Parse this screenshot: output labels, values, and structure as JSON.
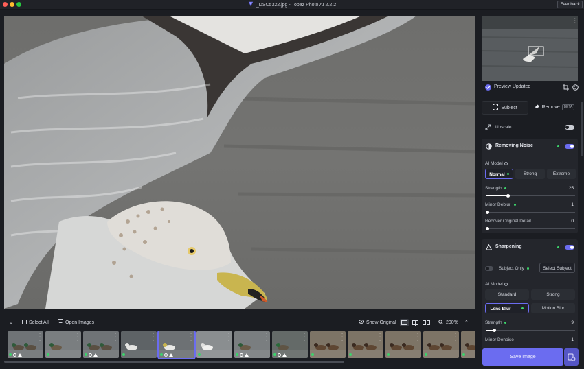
{
  "window": {
    "title": "_DSC5322.jpg - Topaz Photo AI 2.2.2",
    "feedback_label": "Feedback"
  },
  "bottombar": {
    "select_all": "Select All",
    "open_images": "Open Images",
    "show_original": "Show Original",
    "zoom": "200%"
  },
  "filmstrip": {
    "selected_index": 4,
    "thumbnails": [
      {
        "scene": "mallards-water",
        "badges": [
          "dot",
          "circle",
          "triangle"
        ]
      },
      {
        "scene": "mallard-water",
        "badges": [
          "dot"
        ]
      },
      {
        "scene": "mallards-water",
        "badges": [
          "dot",
          "circle",
          "triangle"
        ]
      },
      {
        "scene": "gull-water",
        "badges": [
          "dot"
        ]
      },
      {
        "scene": "gull-flying",
        "badges": [
          "dot",
          "circle",
          "triangle"
        ]
      },
      {
        "scene": "gull-standing",
        "badges": [
          "dot"
        ]
      },
      {
        "scene": "mallard-water",
        "badges": [
          "dot",
          "circle",
          "triangle"
        ]
      },
      {
        "scene": "mallard-green",
        "badges": [
          "dot",
          "circle",
          "triangle"
        ]
      },
      {
        "scene": "ducks-brown",
        "badges": [
          "dot"
        ]
      },
      {
        "scene": "ducks-brown",
        "badges": [
          "dot"
        ]
      },
      {
        "scene": "ducks-brown",
        "badges": [
          "dot"
        ]
      },
      {
        "scene": "ducks-brown",
        "badges": [
          "dot"
        ]
      },
      {
        "scene": "ducks-brown",
        "badges": [
          "dot"
        ]
      }
    ]
  },
  "panel": {
    "preview_status": "Preview Updated",
    "subject_tab": "Subject",
    "remove_tab": "Remove",
    "beta_badge": "BETA",
    "upscale": {
      "label": "Upscale",
      "enabled": false
    },
    "removing_noise": {
      "title": "Removing Noise",
      "enabled": true,
      "ai_model_label": "AI Model",
      "models": [
        "Normal",
        "Strong",
        "Extreme"
      ],
      "selected_model": "Normal",
      "strength_label": "Strength",
      "strength_value": "25",
      "minor_deblur_label": "Minor Deblur",
      "minor_deblur_value": "1",
      "recover_label": "Recover Original Detail",
      "recover_value": "0"
    },
    "sharpening": {
      "title": "Sharpening",
      "enabled": true,
      "subject_only_label": "Subject Only",
      "select_subject": "Select Subject",
      "ai_model_label": "AI Model",
      "models": [
        "Standard",
        "Strong",
        "Lens Blur",
        "Motion Blur"
      ],
      "selected_model": "Lens Blur",
      "strength_label": "Strength",
      "strength_value": "9",
      "minor_denoise_label": "Minor Denoise",
      "minor_denoise_value": "1"
    },
    "save_button": "Save Image"
  },
  "colors": {
    "accent": "#6b6cf0",
    "status_green": "#3cd36b",
    "background": "#1b1d22"
  }
}
